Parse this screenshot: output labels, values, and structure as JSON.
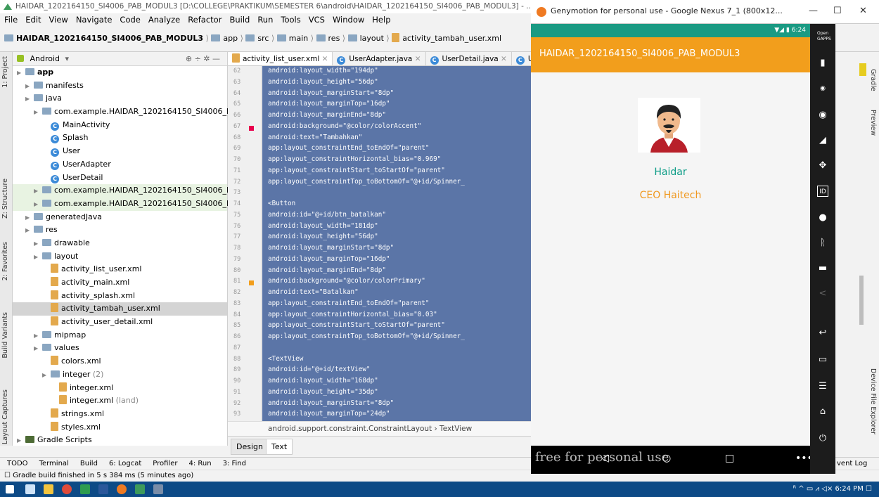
{
  "ide": {
    "window_title": "HAIDAR_1202164150_SI4006_PAB_MODUL3 [D:\\COLLEGE\\PRAKTIKUM\\SEMESTER 6\\android\\HAIDAR_1202164150_SI4006_PAB_MODUL3] - ...\\app\\src\\m",
    "menu": [
      "File",
      "Edit",
      "View",
      "Navigate",
      "Code",
      "Analyze",
      "Refactor",
      "Build",
      "Run",
      "Tools",
      "VCS",
      "Window",
      "Help"
    ],
    "breadcrumbs": [
      "HAIDAR_1202164150_SI4006_PAB_MODUL3",
      "app",
      "src",
      "main",
      "res",
      "layout",
      "activity_tambah_user.xml"
    ],
    "project_view": "Android",
    "left_tabs": [
      "1: Project",
      "Z: Structure",
      "2: Favorites",
      "Build Variants",
      "Layout Captures"
    ],
    "tree": [
      {
        "label": "app",
        "depth": 0,
        "kind": "folder",
        "bold": true
      },
      {
        "label": "manifests",
        "depth": 1,
        "kind": "folder"
      },
      {
        "label": "java",
        "depth": 1,
        "kind": "folder"
      },
      {
        "label": "com.example.HAIDAR_1202164150_SI4006_PA",
        "depth": 2,
        "kind": "folder"
      },
      {
        "label": "MainActivity",
        "depth": 3,
        "kind": "class"
      },
      {
        "label": "Splash",
        "depth": 3,
        "kind": "class"
      },
      {
        "label": "User",
        "depth": 3,
        "kind": "class"
      },
      {
        "label": "UserAdapter",
        "depth": 3,
        "kind": "class"
      },
      {
        "label": "UserDetail",
        "depth": 3,
        "kind": "class"
      },
      {
        "label": "com.example.HAIDAR_1202164150_SI4006_PA",
        "depth": 2,
        "kind": "folder",
        "hl": true
      },
      {
        "label": "com.example.HAIDAR_1202164150_SI4006_PA",
        "depth": 2,
        "kind": "folder",
        "hl": true
      },
      {
        "label": "generatedJava",
        "depth": 1,
        "kind": "folder"
      },
      {
        "label": "res",
        "depth": 1,
        "kind": "folder"
      },
      {
        "label": "drawable",
        "depth": 2,
        "kind": "folder"
      },
      {
        "label": "layout",
        "depth": 2,
        "kind": "folder"
      },
      {
        "label": "activity_list_user.xml",
        "depth": 3,
        "kind": "xml"
      },
      {
        "label": "activity_main.xml",
        "depth": 3,
        "kind": "xml"
      },
      {
        "label": "activity_splash.xml",
        "depth": 3,
        "kind": "xml"
      },
      {
        "label": "activity_tambah_user.xml",
        "depth": 3,
        "kind": "xml",
        "selected": true
      },
      {
        "label": "activity_user_detail.xml",
        "depth": 3,
        "kind": "xml"
      },
      {
        "label": "mipmap",
        "depth": 2,
        "kind": "folder"
      },
      {
        "label": "values",
        "depth": 2,
        "kind": "folder"
      },
      {
        "label": "colors.xml",
        "depth": 3,
        "kind": "xml"
      },
      {
        "label": "integer",
        "depth": 3,
        "kind": "folder",
        "suffix": " (2)"
      },
      {
        "label": "integer.xml",
        "depth": 4,
        "kind": "xml"
      },
      {
        "label": "integer.xml",
        "depth": 4,
        "kind": "xml",
        "suffix": " (land)"
      },
      {
        "label": "strings.xml",
        "depth": 3,
        "kind": "xml"
      },
      {
        "label": "styles.xml",
        "depth": 3,
        "kind": "xml"
      },
      {
        "label": "Gradle Scripts",
        "depth": 0,
        "kind": "gradle"
      }
    ],
    "editor_tabs": [
      "activity_list_user.xml",
      "UserAdapter.java",
      "UserDetail.java",
      "User.j"
    ],
    "line_numbers": [
      "62",
      "63",
      "64",
      "65",
      "66",
      "67",
      "68",
      "69",
      "70",
      "71",
      "72",
      "73",
      "74",
      "75",
      "76",
      "77",
      "78",
      "79",
      "80",
      "81",
      "82",
      "83",
      "84",
      "85",
      "86",
      "87",
      "88",
      "89",
      "90",
      "91",
      "92",
      "93"
    ],
    "code_lines": [
      "        android:layout_width=\"194dp\"",
      "        android:layout_height=\"56dp\"",
      "        android:layout_marginStart=\"8dp\"",
      "        android:layout_marginTop=\"16dp\"",
      "        android:layout_marginEnd=\"8dp\"",
      "        android:background=\"@color/colorAccent\"",
      "        android:text=\"Tambahkan\"",
      "        app:layout_constraintEnd_toEndOf=\"parent\"",
      "        app:layout_constraintHorizontal_bias=\"0.969\"",
      "        app:layout_constraintStart_toStartOf=\"parent\"",
      "        app:layout_constraintTop_toBottomOf=\"@+id/Spinner_",
      "",
      "    <Button",
      "        android:id=\"@+id/btn_batalkan\"",
      "        android:layout_width=\"181dp\"",
      "        android:layout_height=\"56dp\"",
      "        android:layout_marginStart=\"8dp\"",
      "        android:layout_marginTop=\"16dp\"",
      "        android:layout_marginEnd=\"8dp\"",
      "        android:background=\"@color/colorPrimary\"",
      "        android:text=\"Batalkan\"",
      "        app:layout_constraintEnd_toEndOf=\"parent\"",
      "        app:layout_constraintHorizontal_bias=\"0.03\"",
      "        app:layout_constraintStart_toStartOf=\"parent\"",
      "        app:layout_constraintTop_toBottomOf=\"@+id/Spinner_",
      "",
      "    <TextView",
      "        android:id=\"@+id/textView\"",
      "        android:layout_width=\"168dp\"",
      "        android:layout_height=\"35dp\"",
      "        android:layout_marginStart=\"8dp\"",
      "        android:layout_marginTop=\"24dp\""
    ],
    "gutter_colors": {
      "67": "#e8004c",
      "81": "#f29e1c"
    },
    "editor_breadcrumb": "android.support.constraint.ConstraintLayout  ›  TextView",
    "design_tabs": [
      "Design",
      "Text"
    ],
    "bottom_tools": [
      "TODO",
      "Terminal",
      "Build",
      "6: Logcat",
      "Profiler",
      "4: Run",
      "3: Find"
    ],
    "event_log": "vent Log",
    "status": "Gradle build finished in 5 s 384 ms (5 minutes ago)",
    "right_tabs": [
      "Gradle",
      "Preview",
      "Device File Explorer"
    ]
  },
  "emulator": {
    "window_title": "Genymotion for personal use - Google Nexus 7_1 (800x12...",
    "status_time": "6:24",
    "app_title": "HAIDAR_1202164150_SI4006_PAB_MODUL3",
    "profile_name": "Haidar",
    "profile_role": "CEO Haitech",
    "watermark": "free for personal use",
    "colors": {
      "primary": "#f29e1c",
      "status": "#1a9a83",
      "name": "#0b9c86",
      "role": "#f0981e"
    }
  },
  "taskbar": {
    "time": "6:24 PM"
  }
}
